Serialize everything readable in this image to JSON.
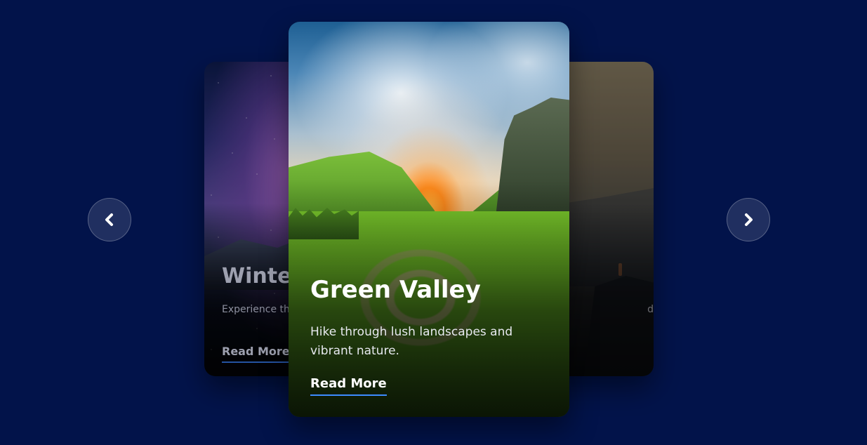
{
  "carousel": {
    "prev_icon": "chevron-left-icon",
    "next_icon": "chevron-right-icon",
    "accent_color": "#3d8bff",
    "background_color": "#02134a",
    "cards": {
      "left": {
        "title": "Winter",
        "description": "Experience the snow-covered",
        "link_label": "Read More"
      },
      "center": {
        "title": "Green Valley",
        "description": "Hike through lush landscapes and vibrant nature.",
        "link_label": "Read More"
      },
      "right": {
        "description_fragment": "d"
      }
    }
  }
}
